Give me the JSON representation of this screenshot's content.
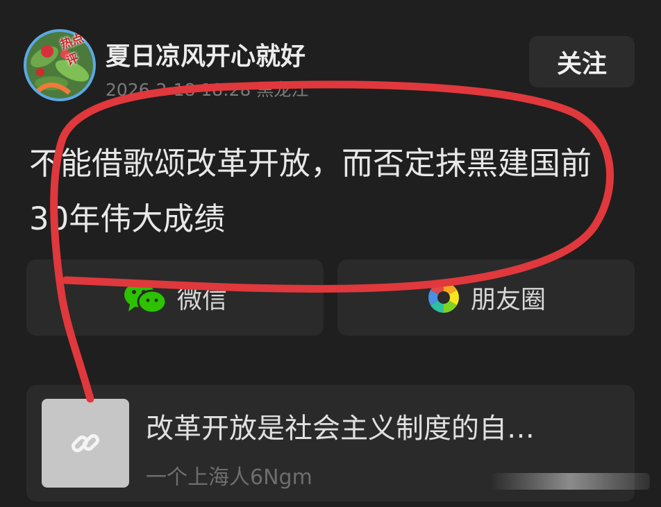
{
  "post": {
    "author": "夏日凉风开心就好",
    "avatar_badge": "热点评",
    "timestamp": "2026-2-18 18:28",
    "location": "黑龙江",
    "follow_label": "关注",
    "text": "不能借歌颂改革开放，而否定抹黑建国前30年伟大成绩"
  },
  "share": {
    "wechat_label": "微信",
    "moments_label": "朋友圈"
  },
  "link_card": {
    "title": "改革开放是社会主义制度的自…",
    "source": "一个上海人6Ngm"
  },
  "colors": {
    "background": "#1f1f1f",
    "card": "#2a2a2a",
    "annotation_red": "#e0383c",
    "wechat_green": "#2dc100"
  },
  "icons": [
    "wechat-icon",
    "moments-icon",
    "link-icon"
  ]
}
